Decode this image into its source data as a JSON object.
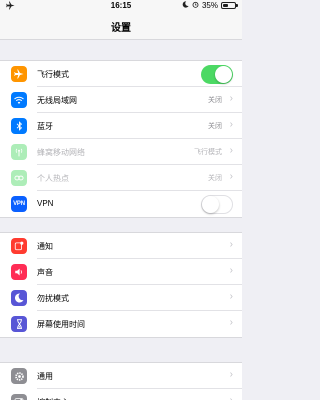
{
  "status_bar": {
    "carrier_icon": "airplane-icon",
    "time": "16:15",
    "battery_percent": "35%",
    "battery_level": 0.35
  },
  "nav": {
    "title": "设置"
  },
  "groups": [
    {
      "rows": [
        {
          "name": "airplane-mode",
          "icon": "airplane-icon",
          "color": "#ff9500",
          "label": "飞行模式",
          "control": "toggle",
          "on": true
        },
        {
          "name": "wlan",
          "icon": "wifi-icon",
          "color": "#007aff",
          "label": "无线局域网",
          "value": "关闭"
        },
        {
          "name": "bluetooth",
          "icon": "bluetooth-icon",
          "color": "#007aff",
          "label": "蓝牙",
          "value": "关闭"
        },
        {
          "name": "cellular",
          "icon": "antenna-icon",
          "color": "#4cd964",
          "label": "蜂窝移动网络",
          "value": "飞行模式",
          "dim": true
        },
        {
          "name": "hotspot",
          "icon": "link-icon",
          "color": "#4cd964",
          "label": "个人热点",
          "value": "关闭",
          "dim": true
        },
        {
          "name": "vpn",
          "icon": "vpn-icon",
          "color": "#0a60ff",
          "label": "VPN",
          "control": "toggle",
          "on": false,
          "icon_text": "VPN"
        }
      ]
    },
    {
      "rows": [
        {
          "name": "notifications",
          "icon": "notification-icon",
          "color": "#ff3b30",
          "label": "通知"
        },
        {
          "name": "sounds",
          "icon": "speaker-icon",
          "color": "#ff2d55",
          "label": "声音"
        },
        {
          "name": "do-not-disturb",
          "icon": "moon-icon",
          "color": "#5856d6",
          "label": "勿扰模式"
        },
        {
          "name": "screen-time",
          "icon": "hourglass-icon",
          "color": "#5856d6",
          "label": "屏幕使用时间"
        }
      ]
    },
    {
      "rows": [
        {
          "name": "general",
          "icon": "gear-icon",
          "color": "#8e8e93",
          "label": "通用"
        },
        {
          "name": "control-center",
          "icon": "switches-icon",
          "color": "#8e8e93",
          "label": "控制中心"
        }
      ]
    }
  ]
}
